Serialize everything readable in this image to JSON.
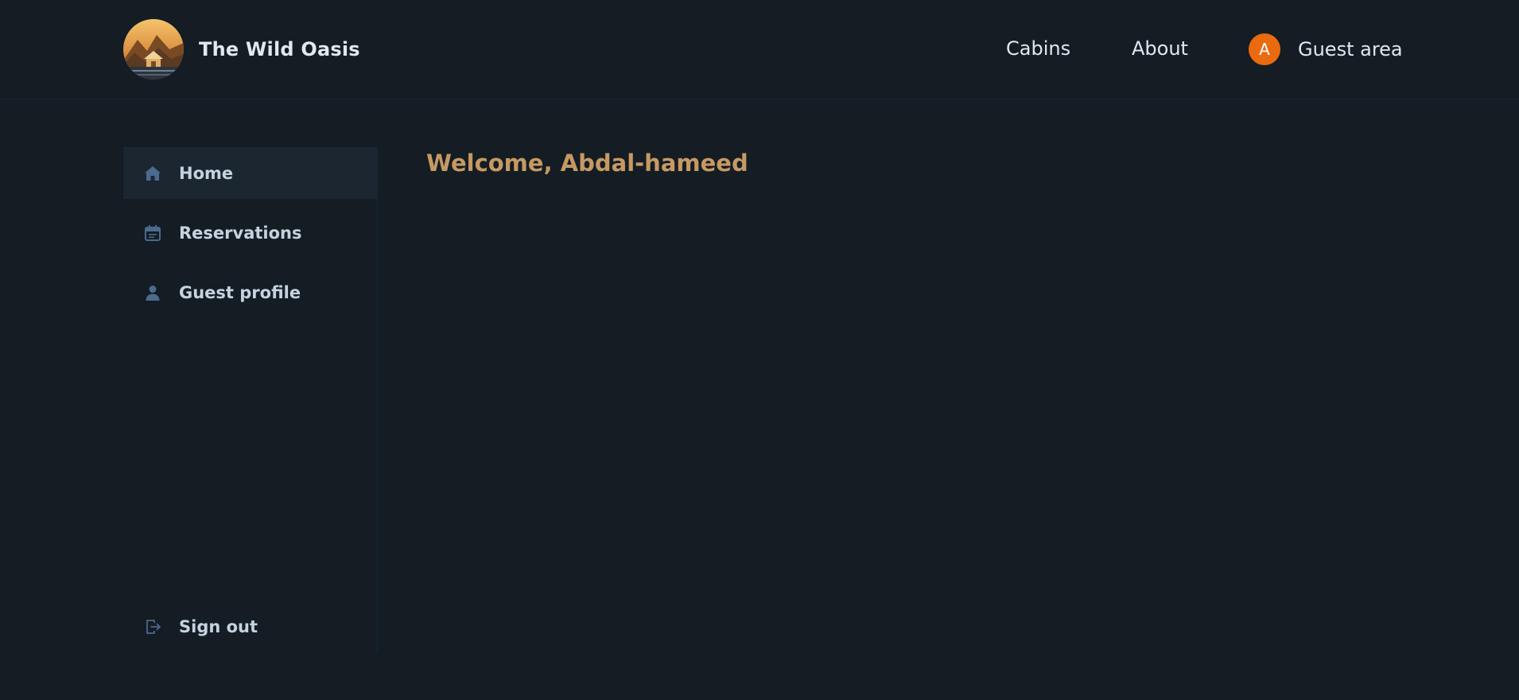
{
  "header": {
    "brand_name": "The Wild Oasis",
    "nav": {
      "cabins": "Cabins",
      "about": "About",
      "guest_area": "Guest area",
      "avatar_initial": "A"
    }
  },
  "sidebar": {
    "items": [
      {
        "label": "Home",
        "icon": "home-icon",
        "active": true
      },
      {
        "label": "Reservations",
        "icon": "calendar-icon",
        "active": false
      },
      {
        "label": "Guest profile",
        "icon": "user-icon",
        "active": false
      }
    ],
    "sign_out": {
      "label": "Sign out",
      "icon": "sign-out-icon"
    }
  },
  "main": {
    "welcome": "Welcome, Abdal-hameed"
  },
  "colors": {
    "background": "#141c24",
    "accent": "#c69963",
    "avatar": "#ea6a0d",
    "icon": "#4c6a8c"
  }
}
